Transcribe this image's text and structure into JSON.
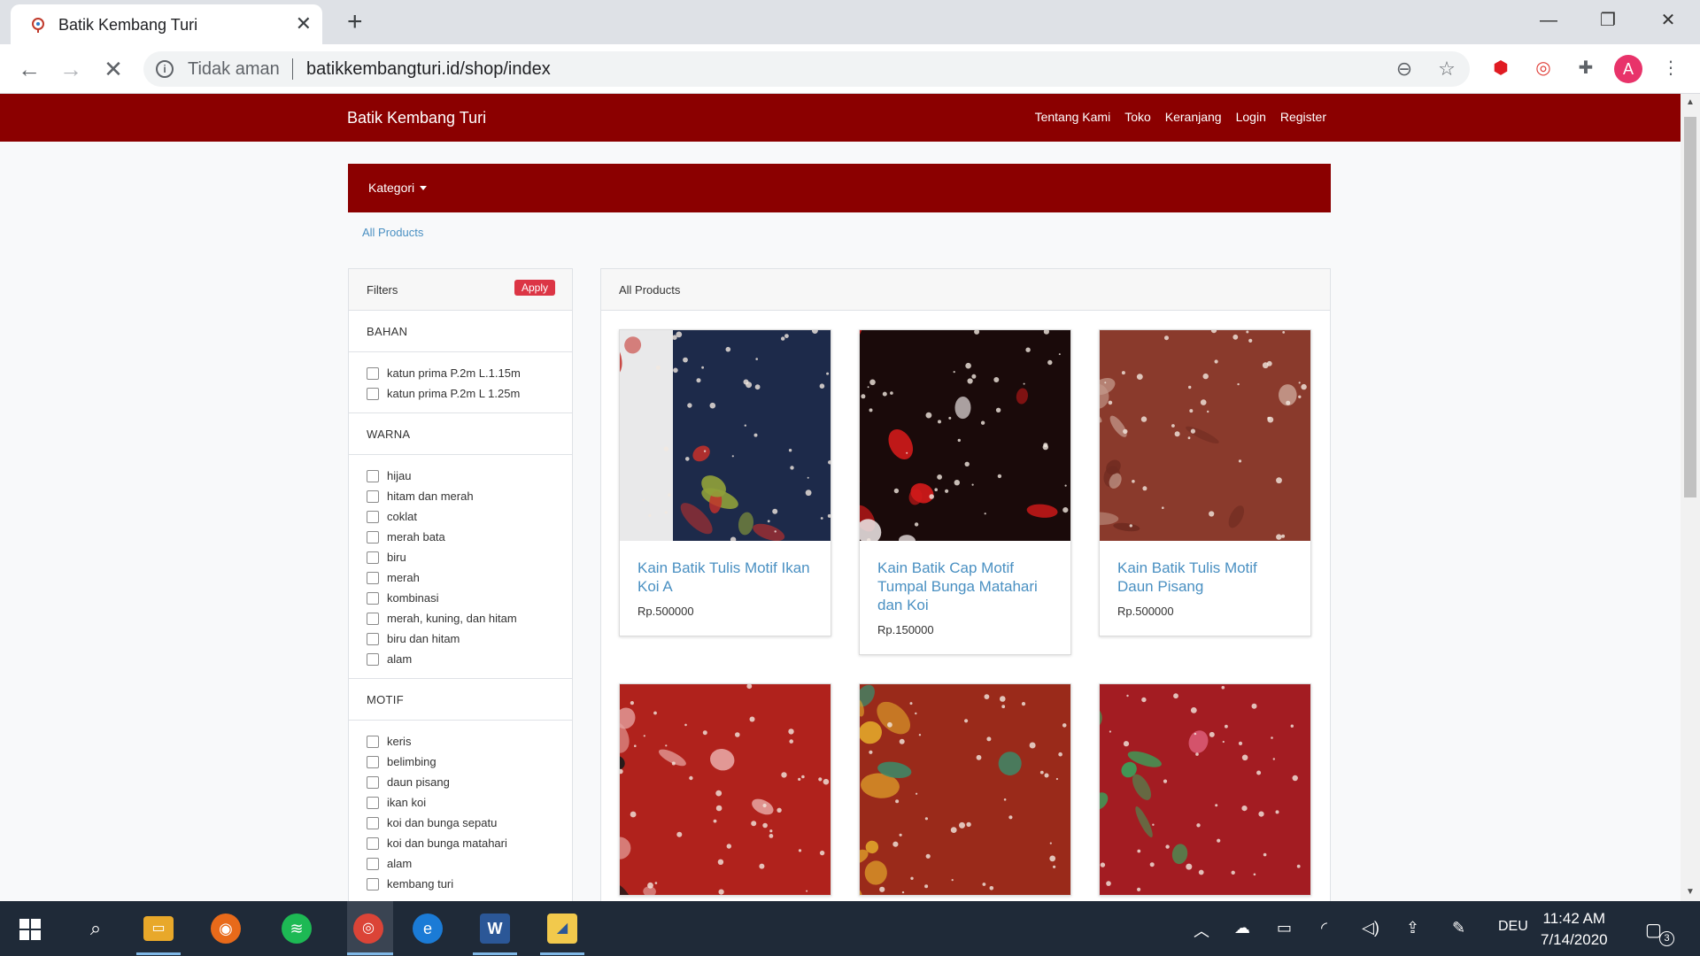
{
  "browser": {
    "tab_title": "Batik Kembang Turi",
    "tab_close": "✕",
    "new_tab": "+",
    "security_label": "Tidak aman",
    "url": "batikkembangturi.id/shop/index",
    "avatar_letter": "A"
  },
  "site": {
    "brand": "Batik Kembang Turi",
    "nav": [
      "Tentang Kami",
      "Toko",
      "Keranjang",
      "Login",
      "Register"
    ],
    "category_toggle": "Kategori",
    "breadcrumb": "All Products"
  },
  "filters": {
    "title": "Filters",
    "apply": "Apply",
    "sections": [
      {
        "title": "BAHAN",
        "items": [
          "katun prima P.2m L.1.15m",
          "katun prima P.2m L 1.25m"
        ]
      },
      {
        "title": "WARNA",
        "items": [
          "hijau",
          "hitam dan merah",
          "coklat",
          "merah bata",
          "biru",
          "merah",
          "kombinasi",
          "merah, kuning, dan hitam",
          "biru dan hitam",
          "alam"
        ]
      },
      {
        "title": "MOTIF",
        "items": [
          "keris",
          "belimbing",
          "daun pisang",
          "ikan koi",
          "koi dan bunga sepatu",
          "koi dan bunga matahari",
          "alam",
          "kembang turi"
        ]
      }
    ]
  },
  "products": {
    "title": "All Products",
    "items": [
      {
        "name": "Kain Batik Tulis Motif Ikan Koi A",
        "price": "Rp.500000",
        "base": "#1d2a4a",
        "accent": "#c4302b",
        "accent2": "#8fa03a"
      },
      {
        "name": "Kain Batik Cap Motif Tumpal Bunga Matahari dan Koi",
        "price": "Rp.150000",
        "base": "#1a0a0a",
        "accent": "#d11a1a",
        "accent2": "#e8e0e0"
      },
      {
        "name": "Kain Batik Tulis Motif Daun Pisang",
        "price": "Rp.500000",
        "base": "#8a3a2c",
        "accent": "#c49a8c",
        "accent2": "#6e2a20"
      },
      {
        "name": "",
        "price": "",
        "base": "#b0221c",
        "accent": "#e6a3a0",
        "accent2": "#1a1a1a"
      },
      {
        "name": "",
        "price": "",
        "base": "#9a2a1a",
        "accent": "#e0a32a",
        "accent2": "#3a8a6a"
      },
      {
        "name": "",
        "price": "",
        "base": "#a31c22",
        "accent": "#3aa05a",
        "accent2": "#e86a8a"
      }
    ]
  },
  "taskbar": {
    "lang": "DEU",
    "time": "11:42 AM",
    "date": "7/14/2020",
    "notifications": "3"
  }
}
